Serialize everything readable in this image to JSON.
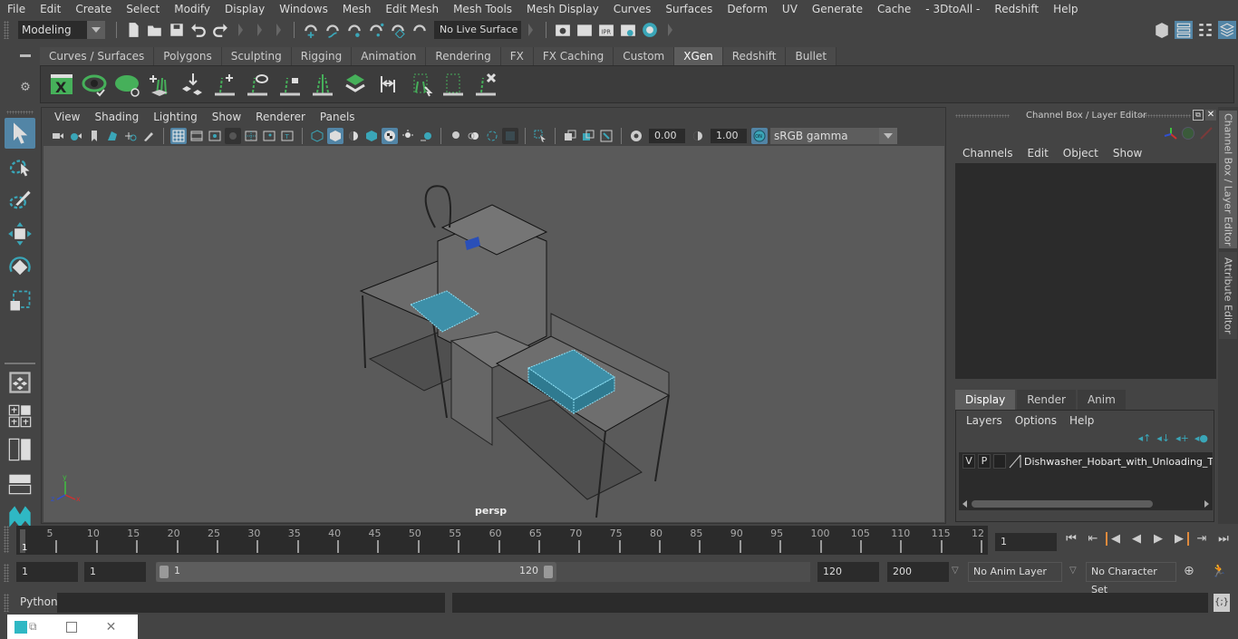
{
  "menubar": {
    "items": [
      "File",
      "Edit",
      "Create",
      "Select",
      "Modify",
      "Display",
      "Windows",
      "Mesh",
      "Edit Mesh",
      "Mesh Tools",
      "Mesh Display",
      "Curves",
      "Surfaces",
      "Deform",
      "UV",
      "Generate",
      "Cache",
      "- 3DtoAll -",
      "Redshift",
      "Help"
    ]
  },
  "statusline": {
    "mode": "Modeling",
    "live_surface": "No Live Surface"
  },
  "shelf": {
    "tabs": [
      "Curves / Surfaces",
      "Polygons",
      "Sculpting",
      "Rigging",
      "Animation",
      "Rendering",
      "FX",
      "FX Caching",
      "Custom",
      "XGen",
      "Redshift",
      "Bullet"
    ],
    "active_tab": "XGen",
    "icons": [
      "xgen-editor-icon",
      "preview-description-icon",
      "hide-preview-icon",
      "create-description-icon",
      "place-guides-icon",
      "add-guide-icon",
      "show-guide-icon",
      "lock-guide-icon",
      "guide-split-icon",
      "sculpt-guides-icon",
      "rebuild-guides-icon",
      "select-guides-icon",
      "create-guides-box-icon",
      "delete-guide-icon"
    ]
  },
  "viewport": {
    "menu": [
      "View",
      "Shading",
      "Lighting",
      "Show",
      "Renderer",
      "Panels"
    ],
    "exposure": "0.00",
    "gamma": "1.00",
    "color_mgmt": "ON",
    "color_space": "sRGB gamma",
    "camera": "persp",
    "axis": {
      "x": "x",
      "y": "y",
      "z": "z"
    }
  },
  "channel_box": {
    "title": "Channel Box / Layer Editor",
    "menu": [
      "Channels",
      "Edit",
      "Object",
      "Show"
    ]
  },
  "layer_editor": {
    "tabs": [
      "Display",
      "Render",
      "Anim"
    ],
    "active_tab": "Display",
    "menu": [
      "Layers",
      "Options",
      "Help"
    ],
    "layers": [
      {
        "v": "V",
        "p": "P",
        "name": "Dishwasher_Hobart_with_Unloading_Ta"
      }
    ]
  },
  "side_tabs": [
    "Channel Box / Layer Editor",
    "Attribute Editor"
  ],
  "timeline": {
    "ticks": [
      "5",
      "10",
      "15",
      "20",
      "25",
      "30",
      "35",
      "40",
      "45",
      "50",
      "55",
      "60",
      "65",
      "70",
      "75",
      "80",
      "85",
      "90",
      "95",
      "100",
      "105",
      "110",
      "115",
      "12"
    ],
    "current_marker": "1",
    "current_frame": "1"
  },
  "range": {
    "start": "1",
    "playback_start": "1",
    "slider_start": "1",
    "slider_end": "120",
    "playback_end": "120",
    "end": "200",
    "anim_layer": "No Anim Layer",
    "character_set": "No Character Set"
  },
  "command": {
    "language": "Python"
  },
  "colors": {
    "accent": "#5285a6",
    "teal": "#3aa6b8",
    "xgen_green": "#46b05a",
    "key_orange": "#e08a3c"
  }
}
